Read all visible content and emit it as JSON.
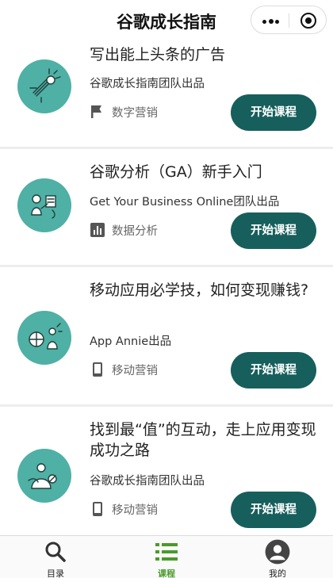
{
  "header": {
    "title": "谷歌成长指南"
  },
  "courses": [
    {
      "title": "写出能上头条的广告",
      "org": "谷歌成长指南团队出品",
      "tag": "数字营销",
      "tag_icon": "flag-icon",
      "button": "开始课程"
    },
    {
      "title": "谷歌分析（GA）新手入门",
      "org": "Get Your Business Online团队出品",
      "tag": "数据分析",
      "tag_icon": "bar-chart-icon",
      "button": "开始课程"
    },
    {
      "title": "移动应用必学技，如何变现赚钱?",
      "org": "App Annie出品",
      "tag": "移动营销",
      "tag_icon": "mobile-phone-icon",
      "button": "开始课程"
    },
    {
      "title": "找到最“值”的互动，走上应用变现成功之路",
      "org": "谷歌成长指南团队出品",
      "tag": "移动营销",
      "tag_icon": "mobile-phone-icon",
      "button": "开始课程"
    }
  ],
  "tabbar": {
    "items": [
      {
        "label": "目录",
        "icon": "search-icon",
        "active": false
      },
      {
        "label": "课程",
        "icon": "list-icon",
        "active": true
      },
      {
        "label": "我的",
        "icon": "user-icon",
        "active": false
      }
    ]
  },
  "colors": {
    "accent": "#175f5c",
    "avatar_bg": "#4fb0a5",
    "tab_active": "#4a9b2a",
    "separator": "#ededed"
  }
}
